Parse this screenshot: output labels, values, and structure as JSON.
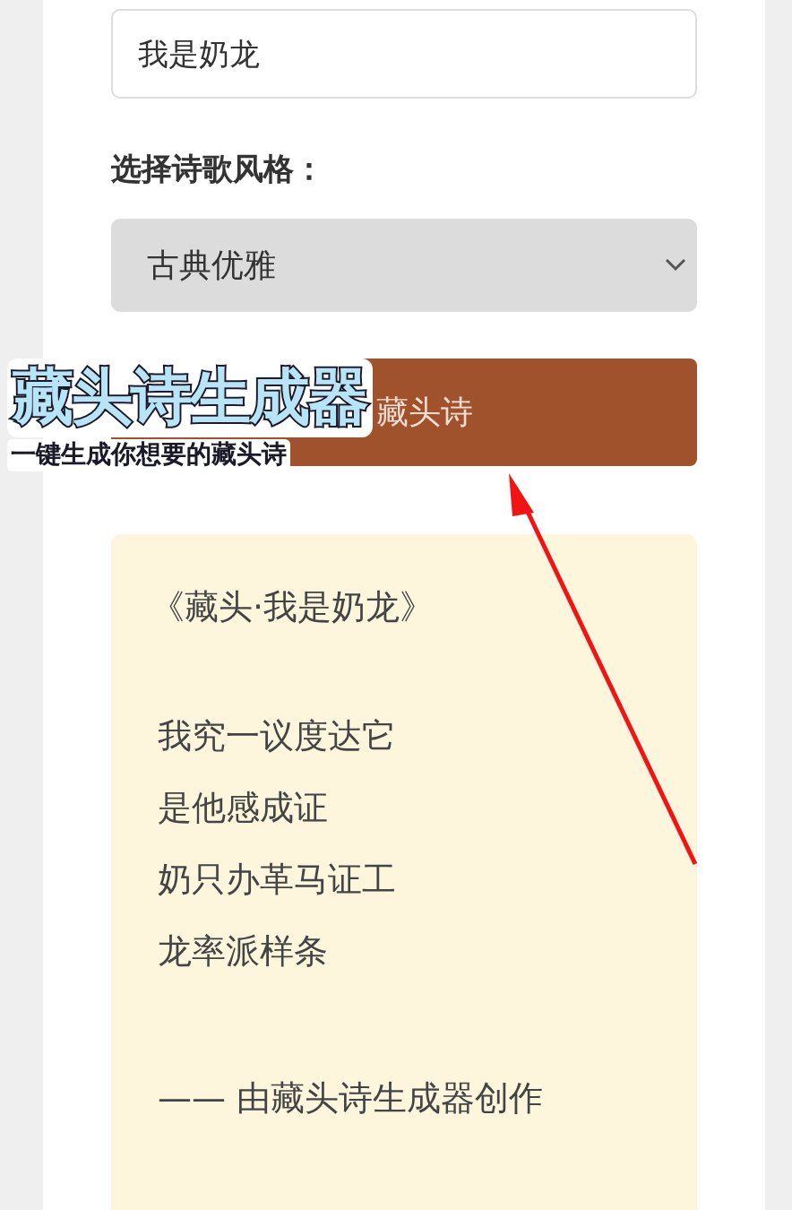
{
  "form": {
    "name_input": {
      "value": "我是奶龙"
    },
    "style_label": "选择诗歌风格：",
    "style_select": {
      "value": "古典优雅"
    },
    "generate_button": {
      "label": "藏头诗"
    }
  },
  "poem": {
    "title": "《藏头·我是奶龙》",
    "lines": [
      "我究一议度达它",
      "是他感成证",
      "奶只办革马证工",
      "龙率派样条"
    ],
    "credit": "—— 由藏头诗生成器创作"
  },
  "caption": {
    "title": "藏头诗生成器",
    "subtitle": "一键生成你想要的藏头诗"
  }
}
